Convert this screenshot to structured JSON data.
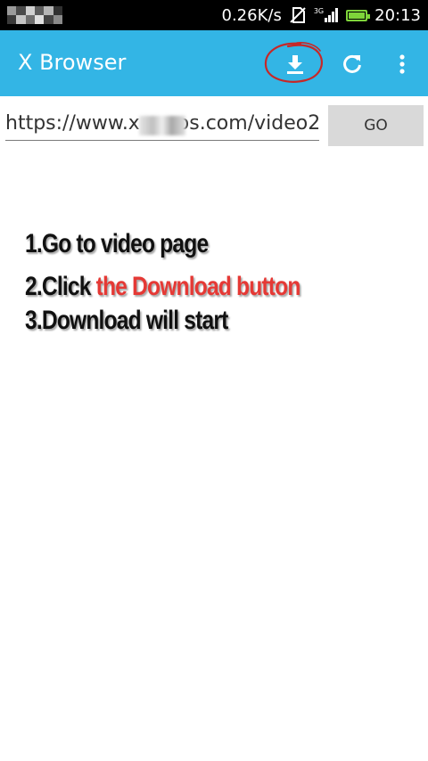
{
  "status_bar": {
    "speed": "0.26K/s",
    "network": "3G",
    "time": "20:13",
    "battery_level": 1.0,
    "colors": {
      "background": "#000000",
      "battery": "#7ed43a"
    }
  },
  "app_bar": {
    "title": "X Browser",
    "color": "#33b5e5",
    "icons": [
      "download-icon",
      "refresh-icon",
      "overflow-menu-icon"
    ]
  },
  "url_bar": {
    "value": "https://www.x      os.com/video2",
    "go_label": "GO"
  },
  "instructions": {
    "step1": "1.Go to video page",
    "step2_prefix": "2.Click ",
    "step2_highlight": "the Download button",
    "step3": "3.Download will start",
    "highlight_color": "#e53935"
  }
}
